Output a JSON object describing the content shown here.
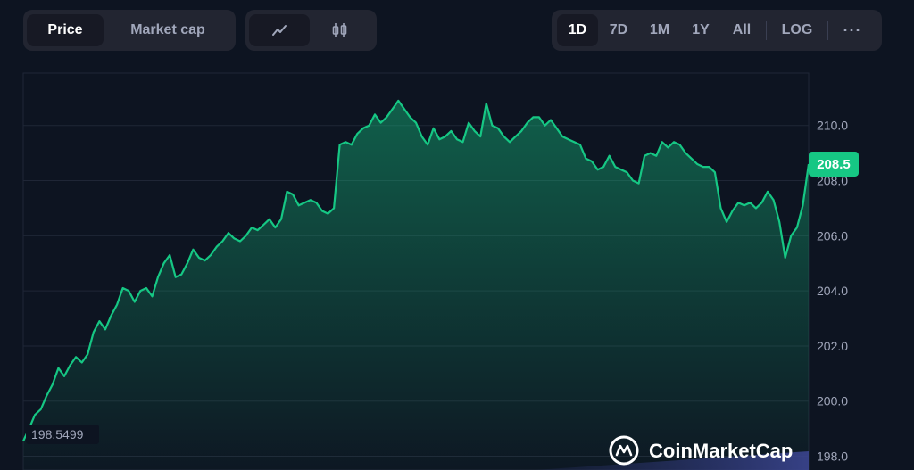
{
  "toolbar": {
    "type_tabs": [
      {
        "label": "Price",
        "active": true
      },
      {
        "label": "Market cap",
        "active": false
      }
    ],
    "view_icons": [
      "line-chart-icon",
      "candlestick-icon"
    ],
    "range_tabs": [
      {
        "label": "1D",
        "active": true
      },
      {
        "label": "7D",
        "active": false
      },
      {
        "label": "1M",
        "active": false
      },
      {
        "label": "1Y",
        "active": false
      },
      {
        "label": "All",
        "active": false
      }
    ],
    "log_label": "LOG",
    "more_label": "···"
  },
  "colors": {
    "background": "#0d1421",
    "line": "#16c784",
    "grid": "#1f2636",
    "badge": "#16c784"
  },
  "current_price_badge": "208.5",
  "open_price_label": "198.5499",
  "watermark": "CoinMarketCap",
  "chart_data": {
    "type": "area",
    "title": "",
    "xlabel": "",
    "ylabel": "",
    "ylim": [
      197.5,
      211.9
    ],
    "yticks": [
      "198.0",
      "200.0",
      "202.0",
      "204.0",
      "206.0",
      "208.0",
      "210.0"
    ],
    "reference_line": 198.5499,
    "grid": true,
    "series": [
      {
        "values": [
          198.55,
          199.0,
          199.5,
          199.7,
          200.2,
          200.6,
          201.2,
          200.9,
          201.3,
          201.6,
          201.4,
          201.7,
          202.5,
          202.9,
          202.6,
          203.1,
          203.5,
          204.1,
          204.0,
          203.6,
          204.0,
          204.1,
          203.8,
          204.5,
          205.0,
          205.3,
          204.5,
          204.6,
          205.0,
          205.5,
          205.2,
          205.1,
          205.3,
          205.6,
          205.8,
          206.1,
          205.9,
          205.8,
          206.0,
          206.3,
          206.2,
          206.4,
          206.6,
          206.3,
          206.6,
          207.6,
          207.5,
          207.1,
          207.2,
          207.3,
          207.2,
          206.9,
          206.8,
          207.0,
          209.3,
          209.4,
          209.3,
          209.7,
          209.9,
          210.0,
          210.4,
          210.1,
          210.3,
          210.6,
          210.9,
          210.6,
          210.3,
          210.1,
          209.6,
          209.3,
          209.9,
          209.5,
          209.6,
          209.8,
          209.5,
          209.4,
          210.1,
          209.8,
          209.6,
          210.8,
          210.0,
          209.9,
          209.6,
          209.4,
          209.6,
          209.8,
          210.1,
          210.3,
          210.3,
          210.0,
          210.2,
          209.9,
          209.6,
          209.5,
          209.4,
          209.3,
          208.8,
          208.7,
          208.4,
          208.5,
          208.9,
          208.5,
          208.4,
          208.3,
          208.0,
          207.9,
          208.9,
          209.0,
          208.9,
          209.4,
          209.2,
          209.4,
          209.3,
          209.0,
          208.8,
          208.6,
          208.5,
          208.5,
          208.3,
          207.0,
          206.5,
          206.9,
          207.2,
          207.1,
          207.2,
          207.0,
          207.2,
          207.6,
          207.3,
          206.5,
          205.2,
          206.0,
          206.3,
          207.1,
          208.6
        ]
      }
    ]
  }
}
